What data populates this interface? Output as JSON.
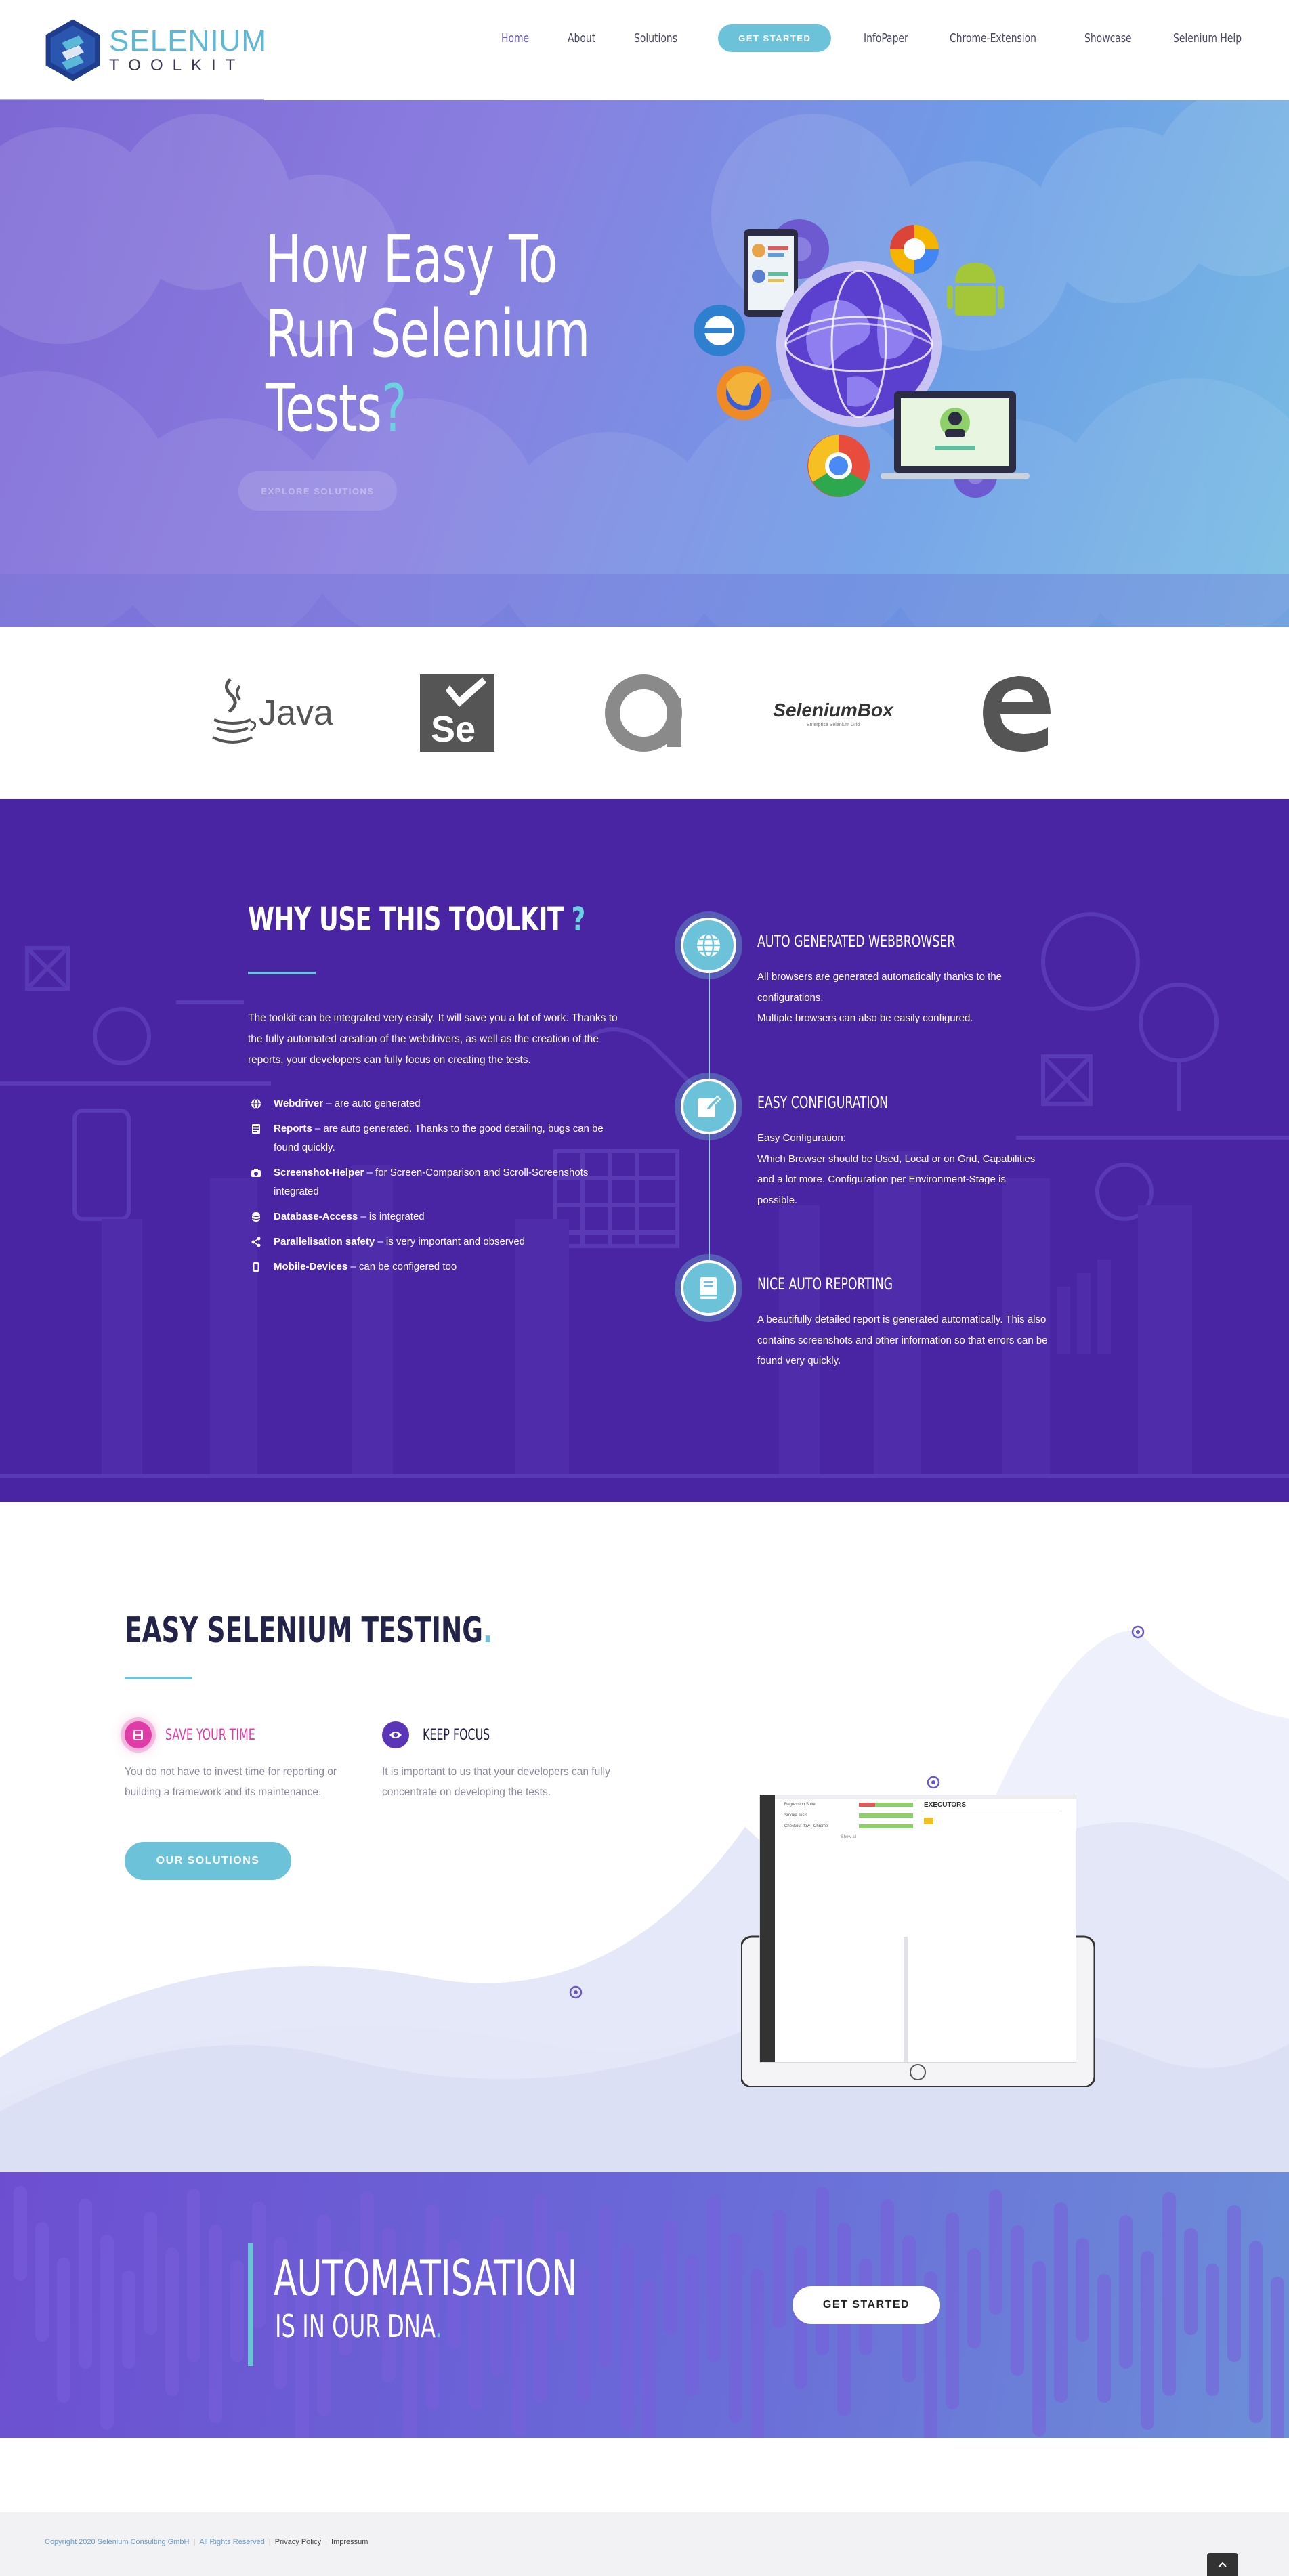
{
  "header": {
    "logo_line1": "SELENIUM",
    "logo_line2": "TOOLKIT",
    "nav": {
      "home": "Home",
      "about": "About",
      "solutions": "Solutions",
      "get_started": "GET STARTED",
      "infopaper": "InfoPaper",
      "chrome_extension": "Chrome-Extension",
      "showcase": "Showcase",
      "help": "Selenium Help"
    }
  },
  "hero": {
    "title_line1": "How Easy To",
    "title_line2": "Run Selenium",
    "title_line3": "Tests",
    "title_mark": "?",
    "button": "EXPLORE SOLUTIONS"
  },
  "logos": {
    "java": "Java",
    "selenium": "Se",
    "seleniumbox": "SeleniumBox",
    "seleniumbox_sub": "Enterprise Selenium Grid"
  },
  "why": {
    "title": "WHY USE THIS TOOLKIT",
    "title_mark": "?",
    "description": "The toolkit can be integrated very easily. It will save you a lot of work. Thanks to the fully automated creation of the webdrivers, as well as the creation of the reports, your developers can fully focus on creating the tests.",
    "list": [
      {
        "icon": "globe-icon",
        "bold": "Webdriver",
        "text": " – are auto generated"
      },
      {
        "icon": "report-icon",
        "bold": "Reports",
        "text": " – are auto generated. Thanks to the good detailing, bugs can be found quickly."
      },
      {
        "icon": "camera-icon",
        "bold": "Screenshot-Helper",
        "text": " – for Screen-Comparison and Scroll-Screenshots integrated"
      },
      {
        "icon": "database-icon",
        "bold": "Database-Access",
        "text": " – is integrated"
      },
      {
        "icon": "share-icon",
        "bold": "Parallelisation safety",
        "text": " – is very important and observed"
      },
      {
        "icon": "mobile-icon",
        "bold": "Mobile-Devices",
        "text": " – can be configered too"
      }
    ],
    "features": [
      {
        "icon": "globe-icon",
        "title": "AUTO GENERATED WEBBROWSER",
        "text": "All browsers are generated automatically thanks to the configurations.\nMultiple browsers can also be easily configured."
      },
      {
        "icon": "edit-icon",
        "title": "EASY CONFIGURATION",
        "text": "Easy Configuration:\nWhich Browser should be Used, Local or on Grid, Capabilities and a lot more. Configuration per Environment-Stage is possible."
      },
      {
        "icon": "book-icon",
        "title": "NICE AUTO REPORTING",
        "text": "A beautifully detailed report is generated automatically. This also contains screenshots and other information so that errors can be found very quickly."
      }
    ]
  },
  "easy": {
    "title": "EASY SELENIUM TESTING",
    "title_mark": ".",
    "services": [
      {
        "icon": "save-icon",
        "title": "SAVE YOUR TIME",
        "text": "You do not have to invest time for reporting or building a framework and its maintenance.",
        "color": "#e03ca8"
      },
      {
        "icon": "eye-icon",
        "title": "KEEP FOCUS",
        "text": "It is important to us that your developers can fully concentrate on developing the tests.",
        "color": "#23234a"
      }
    ],
    "button": "OUR SOLUTIONS",
    "tablet": {
      "panel_title": "EXECUTORS",
      "rows": [
        "Regression Suite",
        "Smoke Tests",
        "Checkout flow - Chrome"
      ],
      "footer": "Show all"
    }
  },
  "dna": {
    "line1": "AUTOMATISATION",
    "line2": "IS IN OUR DNA",
    "line2_mark": ".",
    "button": "GET STARTED"
  },
  "footer": {
    "copyright": "Copyright 2020 Selenium Consulting GmbH",
    "rights": "All Rights Reserved",
    "privacy": "Privacy Policy",
    "imprint": "Impressum"
  },
  "colors": {
    "accent": "#6cc3d9",
    "purple": "#4a25a3",
    "heading": "#23234a",
    "pink": "#e03ca8"
  }
}
